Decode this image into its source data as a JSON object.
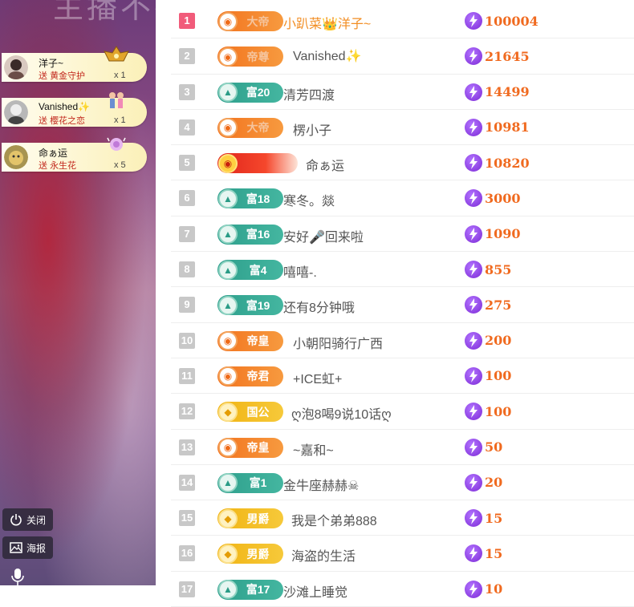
{
  "stream": {
    "top_text": "主播不在"
  },
  "gifts": [
    {
      "user": "洋子~",
      "send_prefix": "送",
      "gift": "黄金守护",
      "count": "x 1",
      "gift_icon": "golden-guard-icon"
    },
    {
      "user": "Vanished✨",
      "send_prefix": "送",
      "gift": "樱花之恋",
      "count": "x 1",
      "gift_icon": "sakura-love-icon"
    },
    {
      "user": "命ぁ运",
      "send_prefix": "送",
      "gift": "永生花",
      "count": "x 5",
      "gift_icon": "eternal-flower-icon"
    }
  ],
  "controls": {
    "close_label": "关闭",
    "poster_label": "海报"
  },
  "ranking": [
    {
      "rank": "1",
      "badge": "大帝",
      "badge_style": "orange-faded",
      "name": "小趴菜👑洋子~",
      "highlight": true,
      "points": "100004"
    },
    {
      "rank": "2",
      "badge": "帝尊",
      "badge_style": "orange-faded",
      "name": "Vanished✨",
      "points": "21645"
    },
    {
      "rank": "3",
      "badge": "富20",
      "badge_style": "teal",
      "name": "清芳四渡",
      "points": "14499"
    },
    {
      "rank": "4",
      "badge": "大帝",
      "badge_style": "orange-faded",
      "name": "楞小子",
      "points": "10981"
    },
    {
      "rank": "5",
      "badge": "",
      "badge_style": "red",
      "name": "命ぁ运",
      "points": "10820"
    },
    {
      "rank": "6",
      "badge": "富18",
      "badge_style": "teal",
      "name": "寒冬。燚",
      "points": "3000"
    },
    {
      "rank": "7",
      "badge": "富16",
      "badge_style": "teal",
      "name": "安好🎤回来啦",
      "points": "1090"
    },
    {
      "rank": "8",
      "badge": "富4",
      "badge_style": "teal",
      "name": "嘻嘻-.",
      "points": "855"
    },
    {
      "rank": "9",
      "badge": "富19",
      "badge_style": "teal",
      "name": "还有8分钟哦",
      "points": "275"
    },
    {
      "rank": "10",
      "badge": "帝皇",
      "badge_style": "orange",
      "name": "小朝阳骑行广西",
      "points": "200"
    },
    {
      "rank": "11",
      "badge": "帝君",
      "badge_style": "orange",
      "name": "+ICE虹+",
      "points": "100"
    },
    {
      "rank": "12",
      "badge": "国公",
      "badge_style": "gold",
      "name": "ღ泡8喝9说10话ღ",
      "points": "100"
    },
    {
      "rank": "13",
      "badge": "帝皇",
      "badge_style": "orange",
      "name": "~嘉和~",
      "points": "50"
    },
    {
      "rank": "14",
      "badge": "富1",
      "badge_style": "teal",
      "name": "金牛座赫赫☠",
      "points": "20"
    },
    {
      "rank": "15",
      "badge": "男爵",
      "badge_style": "gold",
      "name": "我是个弟弟888",
      "points": "15"
    },
    {
      "rank": "16",
      "badge": "男爵",
      "badge_style": "gold",
      "name": "海盗的生活",
      "points": "15"
    },
    {
      "rank": "17",
      "badge": "富17",
      "badge_style": "teal",
      "name": "沙滩上睡觉",
      "points": "10"
    }
  ]
}
